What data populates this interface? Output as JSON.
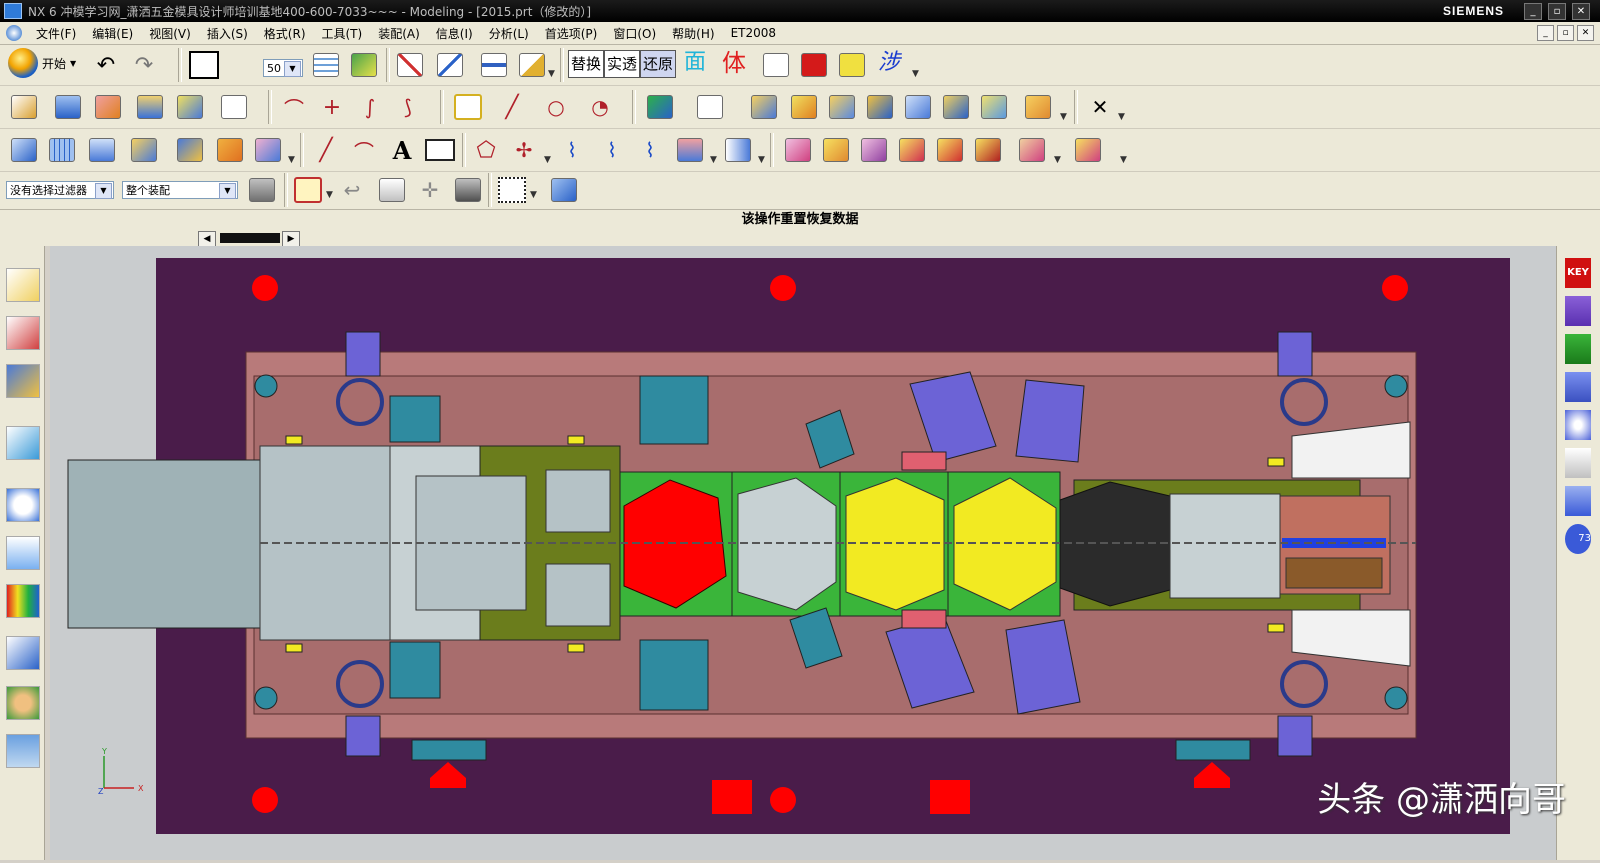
{
  "window": {
    "title": "NX 6 冲模学习网_潇洒五金模具设计师培训基地400-600-7033~~~ - Modeling - [2015.prt（修改的）]",
    "brand": "SIEMENS",
    "controls": [
      "_",
      "▫",
      "✕"
    ]
  },
  "menu": {
    "items": [
      "文件(F)",
      "编辑(E)",
      "视图(V)",
      "插入(S)",
      "格式(R)",
      "工具(T)",
      "装配(A)",
      "信息(I)",
      "分析(L)",
      "首选项(P)",
      "窗口(O)",
      "帮助(H)",
      "ET2008"
    ]
  },
  "toolbar": {
    "start_label": "开始",
    "combo_value": "50",
    "text_buttons": [
      "替换",
      "实透",
      "还原",
      "面",
      "体",
      "涉"
    ]
  },
  "selection_bar": {
    "filter_value": "没有选择过滤器",
    "scope_value": "整个装配"
  },
  "cue_line": "该操作重置恢复数据",
  "sidebar_right": {
    "key_label": "KEY",
    "badge": "73"
  },
  "triad": {
    "y": "Y",
    "x": "X",
    "z": "Z"
  },
  "watermark": "头条 @潇洒向哥",
  "colors": {
    "viewport_bg": "#4a1c4a",
    "die_plate": "#b87a7a",
    "strip_gray": "#9fb2b6",
    "red": "#ff0000",
    "green": "#3ab53a",
    "yellow": "#f2ea22",
    "purple": "#6c63d6",
    "teal": "#2f8ba0",
    "olive": "#6b7d1c"
  }
}
